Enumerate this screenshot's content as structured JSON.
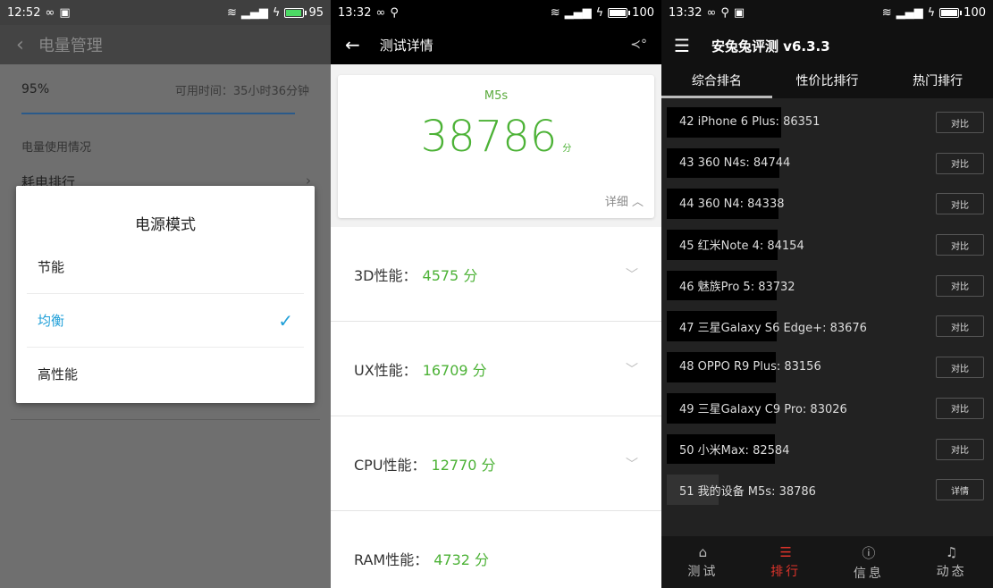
{
  "screen1": {
    "status": {
      "time": "12:52",
      "battery": "95"
    },
    "title": "电量管理",
    "battery_percent": "95%",
    "available_time": "可用时间：35小时36分钟",
    "section_usage": "电量使用情况",
    "item_ranking": "耗电排行",
    "dialog": {
      "title": "电源模式",
      "options": [
        "节能",
        "均衡",
        "高性能"
      ],
      "selected_index": 1
    }
  },
  "screen2": {
    "status": {
      "time": "13:32",
      "battery": "100"
    },
    "title": "测试详情",
    "model": "M5s",
    "score": "38786",
    "score_unit": "分",
    "detail_label": "详细",
    "perf": [
      {
        "label": "3D性能：",
        "value": "4575 分"
      },
      {
        "label": "UX性能：",
        "value": "16709 分"
      },
      {
        "label": "CPU性能：",
        "value": "12770 分"
      },
      {
        "label": "RAM性能：",
        "value": "4732 分"
      }
    ]
  },
  "screen3": {
    "status": {
      "time": "13:32",
      "battery": "100"
    },
    "title": "安兔兔评测 v6.3.3",
    "tabs": [
      "综合排名",
      "性价比排行",
      "热门排行"
    ],
    "ranks": [
      {
        "text": "42 iPhone 6 Plus:  86351",
        "btn": "对比"
      },
      {
        "text": "43 360 N4s:  84744",
        "btn": "对比"
      },
      {
        "text": "44 360 N4:  84338",
        "btn": "对比"
      },
      {
        "text": "45 红米Note 4:  84154",
        "btn": "对比"
      },
      {
        "text": "46 魅族Pro 5:  83732",
        "btn": "对比"
      },
      {
        "text": "47 三星Galaxy S6 Edge+:  83676",
        "btn": "对比"
      },
      {
        "text": "48 OPPO R9 Plus:  83156",
        "btn": "对比"
      },
      {
        "text": "49 三星Galaxy C9 Pro:  83026",
        "btn": "对比"
      },
      {
        "text": "50 小米Max:  82584",
        "btn": "对比"
      },
      {
        "text": "51 我的设备 M5s:  38786",
        "btn": "详情"
      }
    ],
    "nav": [
      {
        "icon": "home-icon",
        "label": "测试"
      },
      {
        "icon": "list-icon",
        "label": "排行"
      },
      {
        "icon": "info-icon",
        "label": "信息"
      },
      {
        "icon": "bell-icon",
        "label": "动态"
      }
    ],
    "nav_active_index": 1
  }
}
